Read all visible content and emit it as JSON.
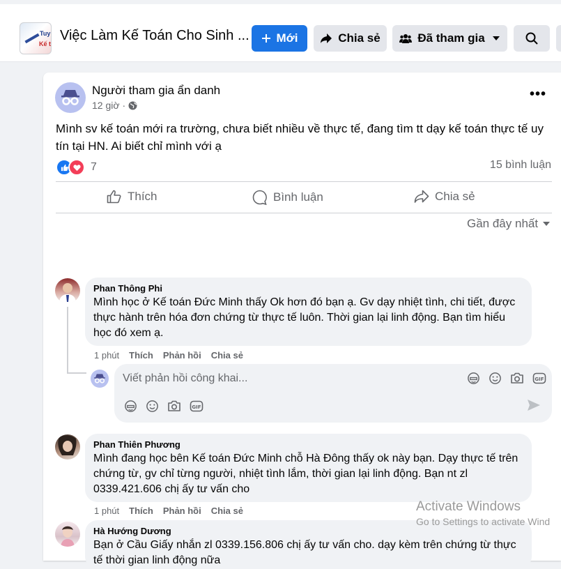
{
  "header": {
    "group_title": "Việc Làm Kế Toán Cho Sinh ...",
    "thumb_text_1": "Tuy",
    "thumb_text_2": "Kế t",
    "new_label": "Mới",
    "share_label": "Chia sẻ",
    "joined_label": "Đã tham gia"
  },
  "post": {
    "author": "Người tham gia ẩn danh",
    "time": "12 giờ",
    "text": "Mình sv kế toán mới ra trường, chưa biết nhiều về thực tế, đang tìm tt dạy kế toán thực tế uy tín tại HN. Ai biết chỉ mình với ạ",
    "reaction_count": "7",
    "comment_count": "15 bình luận",
    "actions": {
      "like": "Thích",
      "comment": "Bình luận",
      "share": "Chia sẻ"
    },
    "sort_label": "Gần đây nhất"
  },
  "comments": [
    {
      "name": "Phan Thông Phi",
      "text": "Mình học ở Kế toán Đức Minh thấy Ok hơn đó bạn ạ. Gv dạy nhiệt tình, chi tiết, được thực hành trên hóa đơn chứng từ thực tế luôn. Thời gian lại linh động. Bạn tìm hiểu học đó xem ạ.",
      "time": "1 phút",
      "like": "Thích",
      "reply": "Phản hồi",
      "share": "Chia sẻ"
    },
    {
      "name": "Phan Thiên Phương",
      "text": "Mình đang học bên Kế toán Đức Minh chỗ Hà Đông thấy ok này bạn. Dạy thực tế trên chứng từ, gv chỉ từng người, nhiệt tình lắm, thời gian lại linh động. Bạn nt zl 0339.421.606 chị ấy tư vấn cho",
      "time": "1 phút",
      "like": "Thích",
      "reply": "Phản hồi",
      "share": "Chia sẻ"
    },
    {
      "name": "Hà Hướng Dương",
      "text": "Bạn ở Cầu Giấy nhắn zl 0339.156.806 chị ấy tư vấn cho. dạy kèm trên chứng từ thực tế thời gian linh động nữa"
    }
  ],
  "reply": {
    "placeholder": "Viết phản hồi công khai..."
  },
  "watermark": {
    "line1": "Activate Windows",
    "line2": "Go to Settings to activate Wind"
  },
  "colors": {
    "accent": "#1b74e4",
    "like_blue": "#1877f2",
    "love_red": "#f33e58"
  }
}
